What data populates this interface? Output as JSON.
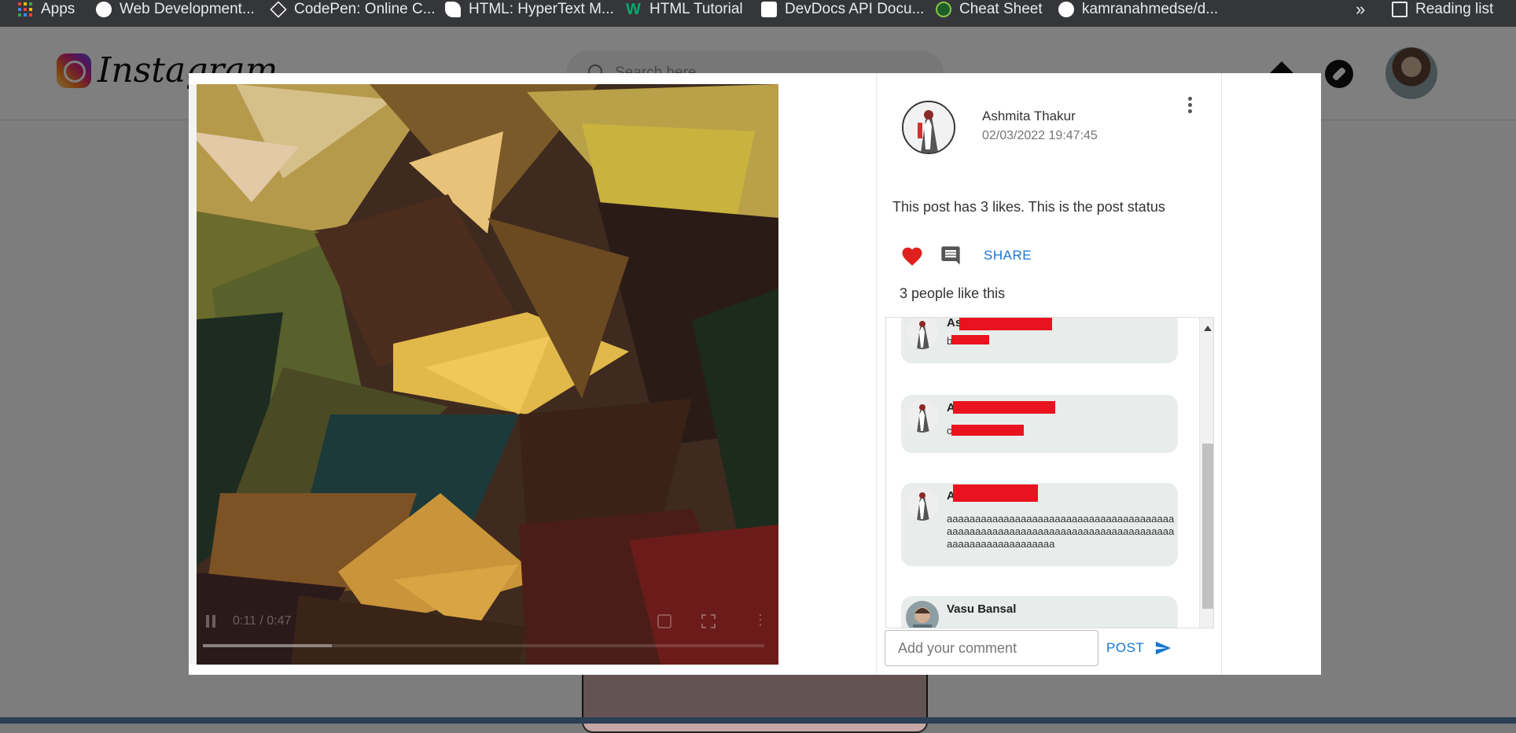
{
  "bookmarks": [
    {
      "label": "Apps",
      "icon": "apps-grid-icon"
    },
    {
      "label": "Web Development...",
      "icon": "web-dev-icon"
    },
    {
      "label": "CodePen: Online C...",
      "icon": "codepen-icon"
    },
    {
      "label": "HTML: HyperText M...",
      "icon": "mdn-icon"
    },
    {
      "label": "HTML Tutorial",
      "icon": "w3schools-icon"
    },
    {
      "label": "DevDocs API Docu...",
      "icon": "devdocs-icon"
    },
    {
      "label": "Cheat Sheet",
      "icon": "cheatsheet-icon"
    },
    {
      "label": "kamranahmedse/d...",
      "icon": "github-icon"
    }
  ],
  "bookmarks_overflow": "»",
  "reading_list": "Reading list",
  "navbar": {
    "brand": "Instagram",
    "search_placeholder": "Search here"
  },
  "modal": {
    "video": {
      "time": "0:11 / 0:47",
      "progress": 0.23
    },
    "post": {
      "author": "Ashmita Thakur",
      "timestamp": "02/03/2022 19:47:45",
      "status": "This post has 3 likes. This is the post status",
      "share_label": "SHARE",
      "likes_text": "3 people like this"
    },
    "comments": [
      {
        "name": "As",
        "text": "b"
      },
      {
        "name": "A",
        "text": "c"
      },
      {
        "name": "A",
        "text": "aaaaaaaaaaaaaaaaaaaaaaaaaaaaaaaaaaaaaaaaaaaaaaaaaaaaaaaaaaaaaaaaaaaaaaaaaaaaaaaaaaaaaaaaaaaaaaaaaaa"
      },
      {
        "name": "Vasu Bansal",
        "text": ""
      }
    ],
    "comment_input_placeholder": "Add your comment",
    "post_label": "POST"
  },
  "colors": {
    "accent": "#1976d2",
    "like": "#e0201c",
    "redaction": "#e8131f"
  }
}
